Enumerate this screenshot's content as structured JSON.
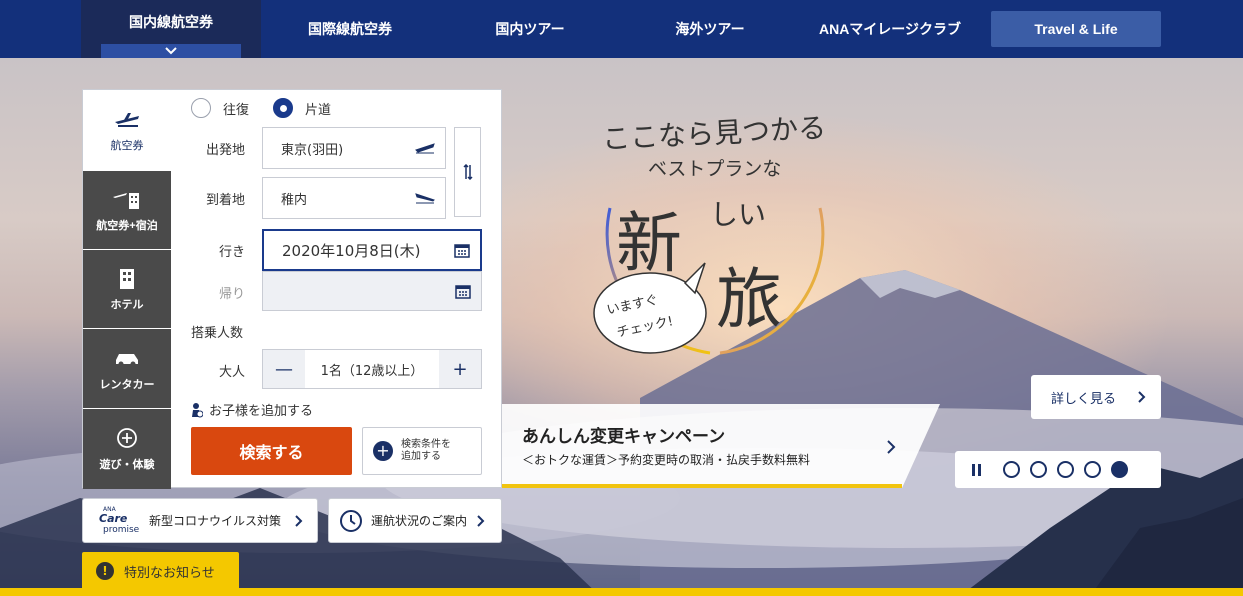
{
  "nav": {
    "items": [
      "国内線航空券",
      "国際線航空券",
      "国内ツアー",
      "海外ツアー",
      "ANAマイレージクラブ",
      "Travel & Life"
    ],
    "active_index": 0
  },
  "side_tabs": [
    {
      "label": "航空券",
      "icon": "airplane-icon",
      "active": true
    },
    {
      "label": "航空券+宿泊",
      "icon": "plane-hotel-icon",
      "active": false
    },
    {
      "label": "ホテル",
      "icon": "building-icon",
      "active": false
    },
    {
      "label": "レンタカー",
      "icon": "car-icon",
      "active": false
    },
    {
      "label": "遊び・体験",
      "icon": "plus-circle-icon",
      "active": false
    }
  ],
  "trip_type": {
    "options": [
      "往復",
      "片道"
    ],
    "selected": "片道"
  },
  "form": {
    "departure_label": "出発地",
    "departure_value": "東京(羽田)",
    "arrival_label": "到着地",
    "arrival_value": "稚内",
    "outbound_label": "行き",
    "outbound_value": "2020年10月8日(木)",
    "return_label": "帰り",
    "return_value": "",
    "passengers_heading": "搭乗人数",
    "adult_label": "大人",
    "adult_value": "1名（12歳以上）",
    "minus": "—",
    "plus": "+",
    "add_child": "お子様を追加する",
    "search_button": "検索する",
    "conditions_button_line1": "検索条件を",
    "conditions_button_line2": "追加する"
  },
  "info_buttons": {
    "care_logo_top": "ANA",
    "care_logo_mid": "Care",
    "care_logo_bottom": "promise",
    "covid": "新型コロナウイルス対策",
    "flight_status": "運航状況のご案内"
  },
  "notice": {
    "icon": "!",
    "label": "特別なお知らせ"
  },
  "hero": {
    "line1": "ここなら見つかる",
    "line2": "ベストプランな",
    "big1": "新",
    "small": "しい",
    "big2": "旅",
    "bubble1": "いますぐ",
    "bubble2": "チェック!"
  },
  "campaign": {
    "title": "あんしん変更キャンペーン",
    "subtitle": "＜おトクな運賃＞予約変更時の取消・払戻手数料無料"
  },
  "detail_button": "詳しく見る",
  "carousel": {
    "count": 5,
    "active_index": 4
  }
}
